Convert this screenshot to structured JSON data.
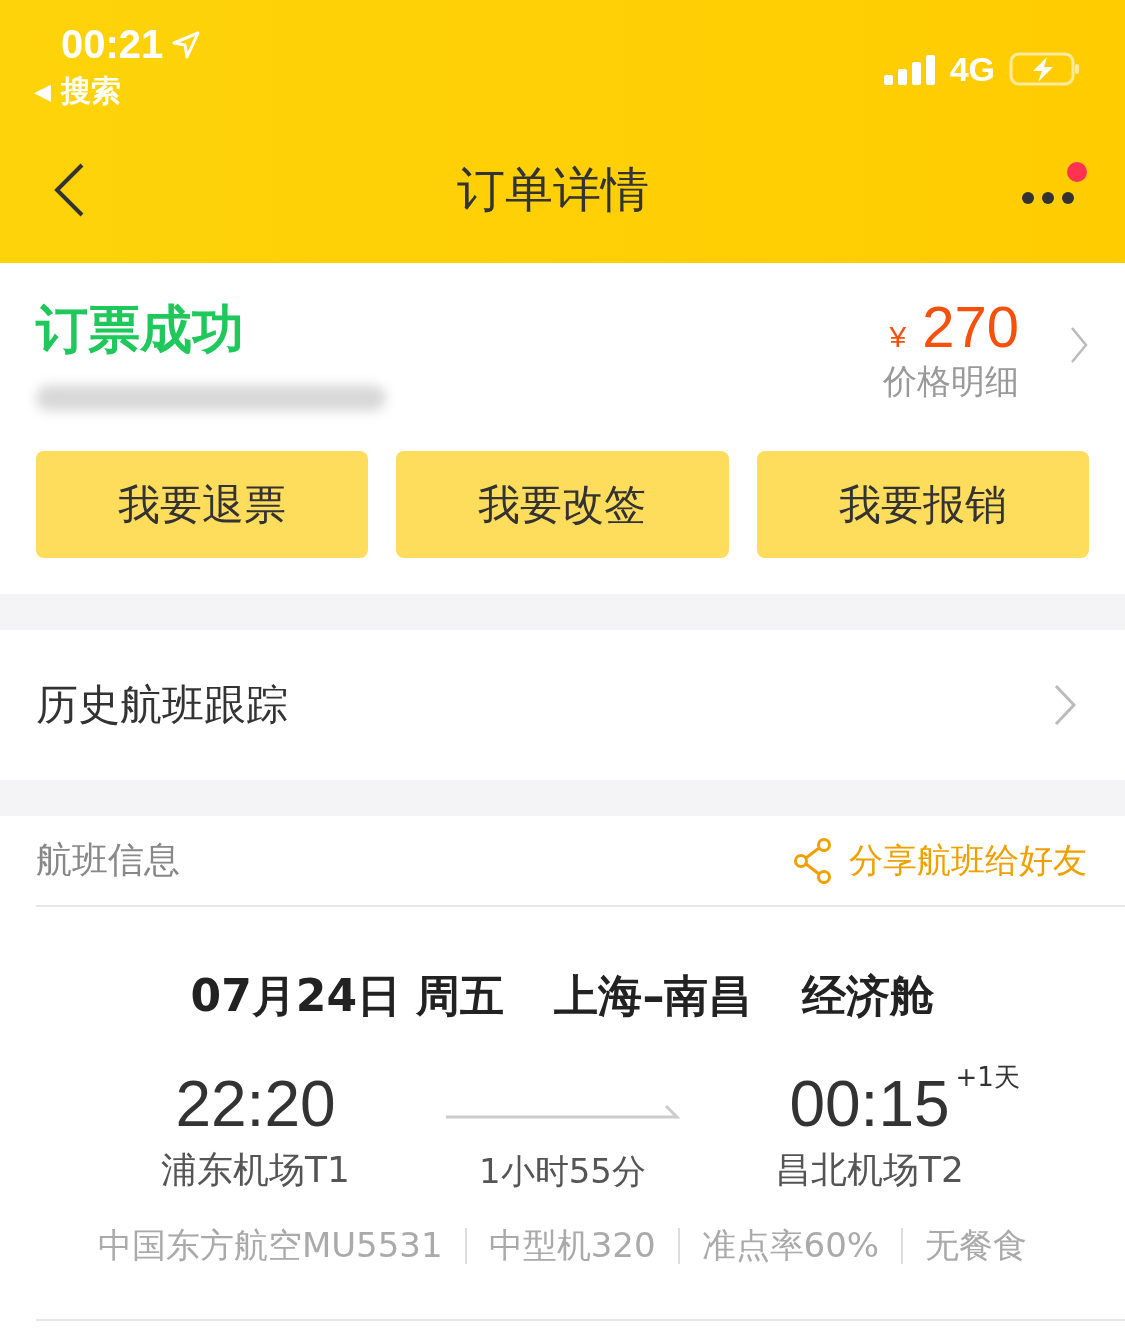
{
  "status_bar": {
    "time": "00:21",
    "back_glyph": "◀",
    "back_label": "搜索",
    "network": "4G"
  },
  "nav": {
    "title": "订单详情",
    "has_notification": true
  },
  "order": {
    "status": "订票成功",
    "currency": "¥",
    "price": "270",
    "price_link": "价格明细",
    "actions": [
      "我要退票",
      "我要改签",
      "我要报销"
    ]
  },
  "history_row": {
    "label": "历史航班跟踪"
  },
  "flight_info": {
    "title": "航班信息",
    "share_label": "分享航班给好友",
    "date": "07月24日 周五",
    "route": "上海–南昌",
    "cabin": "经济舱",
    "departure": {
      "time": "22:20",
      "airport": "浦东机场T1"
    },
    "arrival": {
      "time": "00:15",
      "day_offset": "+1天",
      "airport": "昌北机场T2"
    },
    "duration": "1小时55分",
    "details": [
      "中国东方航空MU5531",
      "中型机320",
      "准点率60%",
      "无餐食"
    ]
  }
}
